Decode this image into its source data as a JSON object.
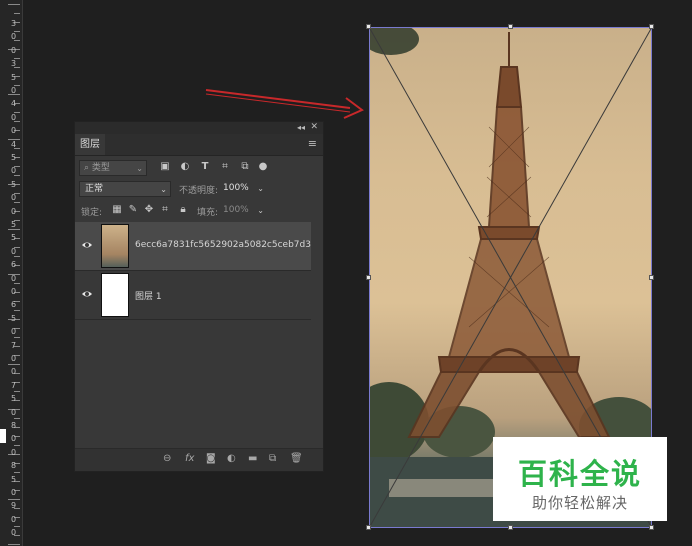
{
  "ruler": {
    "numbers": [
      "3",
      "0",
      "0",
      "3",
      "5",
      "0",
      "4",
      "0",
      "0",
      "4",
      "5",
      "0",
      "5",
      "0",
      "0",
      "5",
      "5",
      "0",
      "6",
      "0",
      "0",
      "6",
      "5",
      "0",
      "7",
      "0",
      "0",
      "7",
      "5",
      "0",
      "8",
      "0",
      "0",
      "8",
      "5",
      "0",
      "9",
      "0",
      "0"
    ]
  },
  "panel": {
    "tab_label": "图层",
    "filter_placeholder": "类型",
    "blend_mode": "正常",
    "opacity_label": "不透明度:",
    "opacity_value": "100%",
    "lock_label": "锁定:",
    "fill_label": "填充:",
    "fill_value": "100%",
    "layers": [
      {
        "name": "6ecc6a7831fc5652902a5082c5ceb7d3",
        "selected": true
      },
      {
        "name": "图层 1",
        "selected": false
      }
    ],
    "footer_icons": [
      "link-icon",
      "fx-icon",
      "mask-icon",
      "adjustment-icon",
      "folder-icon",
      "new-layer-icon",
      "trash-icon"
    ]
  },
  "watermark": {
    "title": "百科全说",
    "subtitle": "助你轻松解决"
  },
  "colors": {
    "arrow": "#c8282a",
    "transform_frame": "#7a7ad0",
    "watermark_green": "#2eb34b"
  }
}
